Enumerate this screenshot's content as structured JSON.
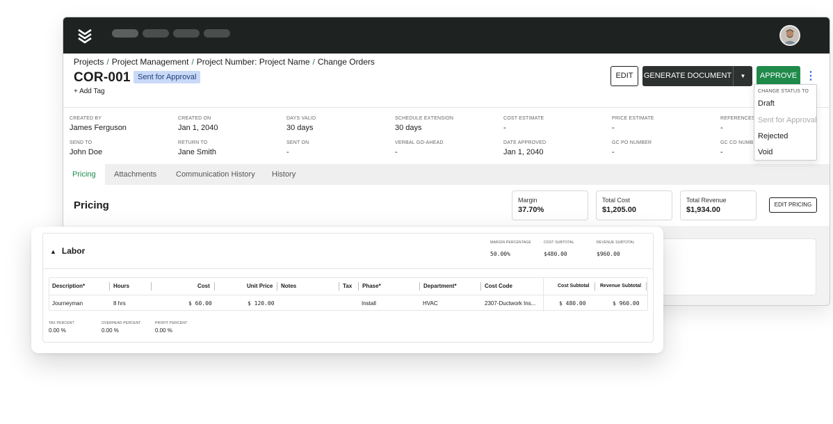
{
  "header": {
    "logo": "chevron-stack-logo",
    "avatar": "user-avatar"
  },
  "breadcrumb": [
    "Projects",
    "Project Management",
    "Project Number: Project Name",
    "Change Orders"
  ],
  "breadcrumb_separator": "/",
  "page": {
    "title": "COR-001",
    "status": "Sent for Approval",
    "add_tag": "+ Add Tag"
  },
  "actions": {
    "edit": "EDIT",
    "generate": "GENERATE DOCUMENT",
    "approve": "APPROVE",
    "more": "⋮"
  },
  "status_menu": {
    "heading": "CHANGE STATUS TO",
    "items": [
      "Draft",
      "Sent for Approval",
      "Rejected",
      "Void"
    ]
  },
  "meta": {
    "created_by": {
      "label": "CREATED BY",
      "value": "James Ferguson"
    },
    "created_on": {
      "label": "CREATED ON",
      "value": "Jan 1, 2040"
    },
    "days_valid": {
      "label": "DAYS VALID",
      "value": "30 days"
    },
    "schedule_extension": {
      "label": "SCHEDULE EXTENSION",
      "value": "30 days"
    },
    "cost_estimate": {
      "label": "COST ESTIMATE",
      "value": "-"
    },
    "price_estimate": {
      "label": "PRICE ESTIMATE",
      "value": "-"
    },
    "references": {
      "label": "REFERENCES",
      "value": "-"
    },
    "send_to": {
      "label": "SEND TO",
      "value": "John Doe"
    },
    "return_to": {
      "label": "RETURN TO",
      "value": "Jane Smith"
    },
    "sent_on": {
      "label": "SENT ON",
      "value": "-"
    },
    "verbal_go_ahead": {
      "label": "VERBAL GO-AHEAD",
      "value": "-"
    },
    "date_approved": {
      "label": "DATE APPROVED",
      "value": "Jan 1, 2040"
    },
    "gc_po_number": {
      "label": "GC PO NUMBER",
      "value": "-"
    },
    "gc_co_number": {
      "label": "GC CO NUMB",
      "value": "-"
    }
  },
  "tabs": [
    "Pricing",
    "Attachments",
    "Communication History",
    "History"
  ],
  "pricing": {
    "title": "Pricing",
    "margin": {
      "label": "Margin",
      "value": "37.70%"
    },
    "total_cost": {
      "label": "Total Cost",
      "value": "$1,205.00"
    },
    "total_revenue": {
      "label": "Total Revenue",
      "value": "$1,934.00"
    },
    "edit_pricing": "EDIT PRICING"
  },
  "labor": {
    "title": "Labor",
    "collapse_icon": "chevron-up-icon",
    "summary": {
      "margin_percentage": {
        "label": "MARGIN PERCENTAGE",
        "value": "50.00%"
      },
      "cost_subtotal": {
        "label": "COST SUBTOTAL",
        "value": "$480.00"
      },
      "revenue_subtotal": {
        "label": "REVENUE SUBTOTAL",
        "value": "$960.00"
      }
    },
    "columns": [
      "Description*",
      "Hours",
      "Cost",
      "Unit Price",
      "Notes",
      "Tax",
      "Phase*",
      "Department*",
      "Cost Code",
      "Cost Subtotal",
      "Revenue Subtotal"
    ],
    "rows": [
      {
        "description": "Journeyman",
        "hours": "8 hrs",
        "cost": "$ 60.00",
        "unit_price": "$ 120.00",
        "notes": "",
        "tax": "",
        "phase": "Install",
        "department": "HVAC",
        "cost_code": "2307-Ductwork Ins...",
        "cost_subtotal": "$ 480.00",
        "revenue_subtotal": "$ 960.00"
      }
    ],
    "footer": {
      "tax_percent": {
        "label": "TAX PERCENT",
        "value": "0.00 %"
      },
      "overhead_percent": {
        "label": "OVERHEAD PERCENT",
        "value": "0.00 %"
      },
      "profit_percent": {
        "label": "PROFIT PERCENT",
        "value": "0.00 %"
      }
    }
  },
  "colors": {
    "topbar": "#1e2322",
    "accent_green": "#1f8a4a",
    "status_pill": "#c9d9f7",
    "more_icon": "#2f6fe0"
  }
}
